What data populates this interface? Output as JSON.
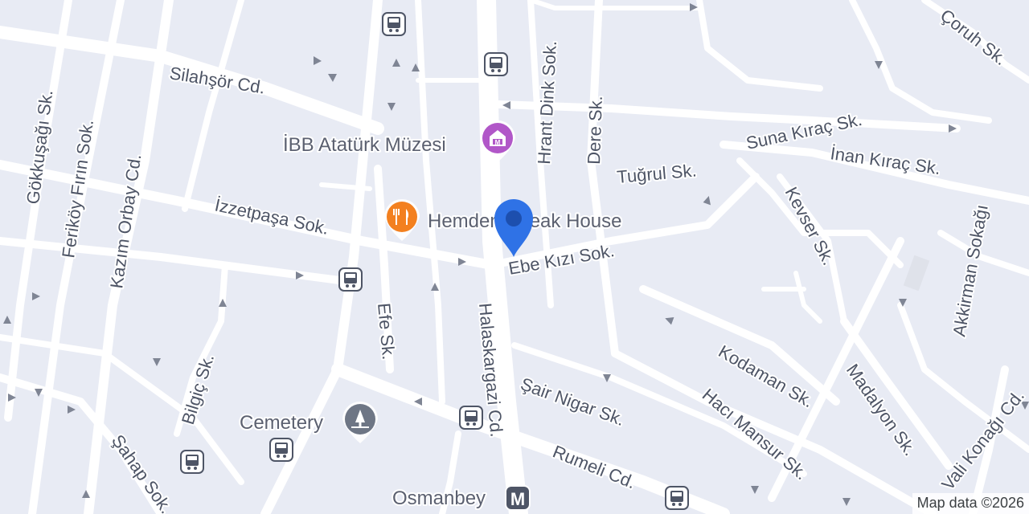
{
  "map": {
    "streets": [
      "Silahşör Cd.",
      "Gökkuşağı Sk.",
      "Feriköy Fırın Sok.",
      "Kazım Orbay Cd.",
      "İzzetpaşa Sok.",
      "Efe Sk.",
      "Bilgiç Sk.",
      "Şahap Sok.",
      "Halaskargazi Cd.",
      "Hrant Dink Sok.",
      "Dere Sk.",
      "Tuğrul Sk.",
      "Suna Kıraç Sk.",
      "İnan Kıraç Sk.",
      "Çoruh Sk.",
      "Kevser Sk.",
      "Akkirman Sokağı",
      "Ebe Kızı Sok.",
      "Kodaman Sk.",
      "Madalyon Sk.",
      "Şair Nigar Sk.",
      "Hacı Mansur Sk.",
      "Rumeli Cd.",
      "Vali Konağı Cd."
    ],
    "pois": {
      "museum": "İBB Atatürk Müzesi",
      "restaurant": "Hemdem Steak House",
      "cemetery": "Cemetery",
      "metro": "Osmanbey"
    },
    "metro_icon_letter": "M",
    "attribution": "Map data ©2026",
    "colors": {
      "background": "#e8ebf4",
      "road": "#ffffff",
      "pin": "#2f72e6",
      "restaurant": "#f3801f",
      "museum": "#b157c8",
      "cemetery": "#6e7685",
      "transit": "#4e5566"
    }
  }
}
